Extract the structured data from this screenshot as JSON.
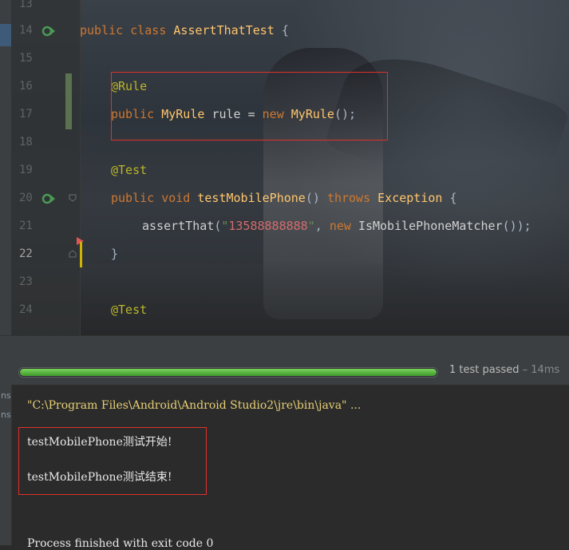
{
  "editor": {
    "lines": [
      {
        "num": "13"
      },
      {
        "num": "14",
        "run_icon": "run-gutter-icon"
      },
      {
        "num": "15"
      },
      {
        "num": "16"
      },
      {
        "num": "17"
      },
      {
        "num": "18"
      },
      {
        "num": "19"
      },
      {
        "num": "20",
        "run_icon": "run-gutter-icon"
      },
      {
        "num": "21"
      },
      {
        "num": "22"
      },
      {
        "num": "23"
      },
      {
        "num": "24"
      }
    ],
    "code": {
      "l14": {
        "kw1": "public",
        "kw2": "class",
        "cls": "AssertThatTest",
        "brace": "{"
      },
      "l16": {
        "ann": "@Rule"
      },
      "l17": {
        "kw1": "public",
        "type": "MyRule",
        "name": "rule",
        "eq": "=",
        "kw2": "new",
        "ctor": "MyRule",
        "end": "();"
      },
      "l19": {
        "ann": "@Test"
      },
      "l20": {
        "kw1": "public",
        "kw2": "void",
        "method": "testMobilePhone",
        "paren": "()",
        "kw3": "throws",
        "exc": "Exception",
        "brace": "{"
      },
      "l21": {
        "call": "assertThat",
        "open": "(",
        "str": "\"13588888888\"",
        "comma": ",",
        "kw": "new",
        "cls": "IsMobilePhoneMatcher",
        "end": "());"
      },
      "l22": {
        "brace": "}"
      },
      "l24": {
        "ann": "@Test"
      }
    }
  },
  "test_runner": {
    "progress": 1.0,
    "status": "1 test passed",
    "duration": "– 14ms",
    "progress_color": "#5cb843"
  },
  "console": {
    "side_tabs": [
      "ns",
      "ns"
    ],
    "command": "\"C:\\Program Files\\Android\\Android Studio2\\jre\\bin\\java\" ...",
    "out1": "testMobilePhone测试开始!",
    "out2": "testMobilePhone测试结束!",
    "exit": "Process finished with exit code 0"
  }
}
